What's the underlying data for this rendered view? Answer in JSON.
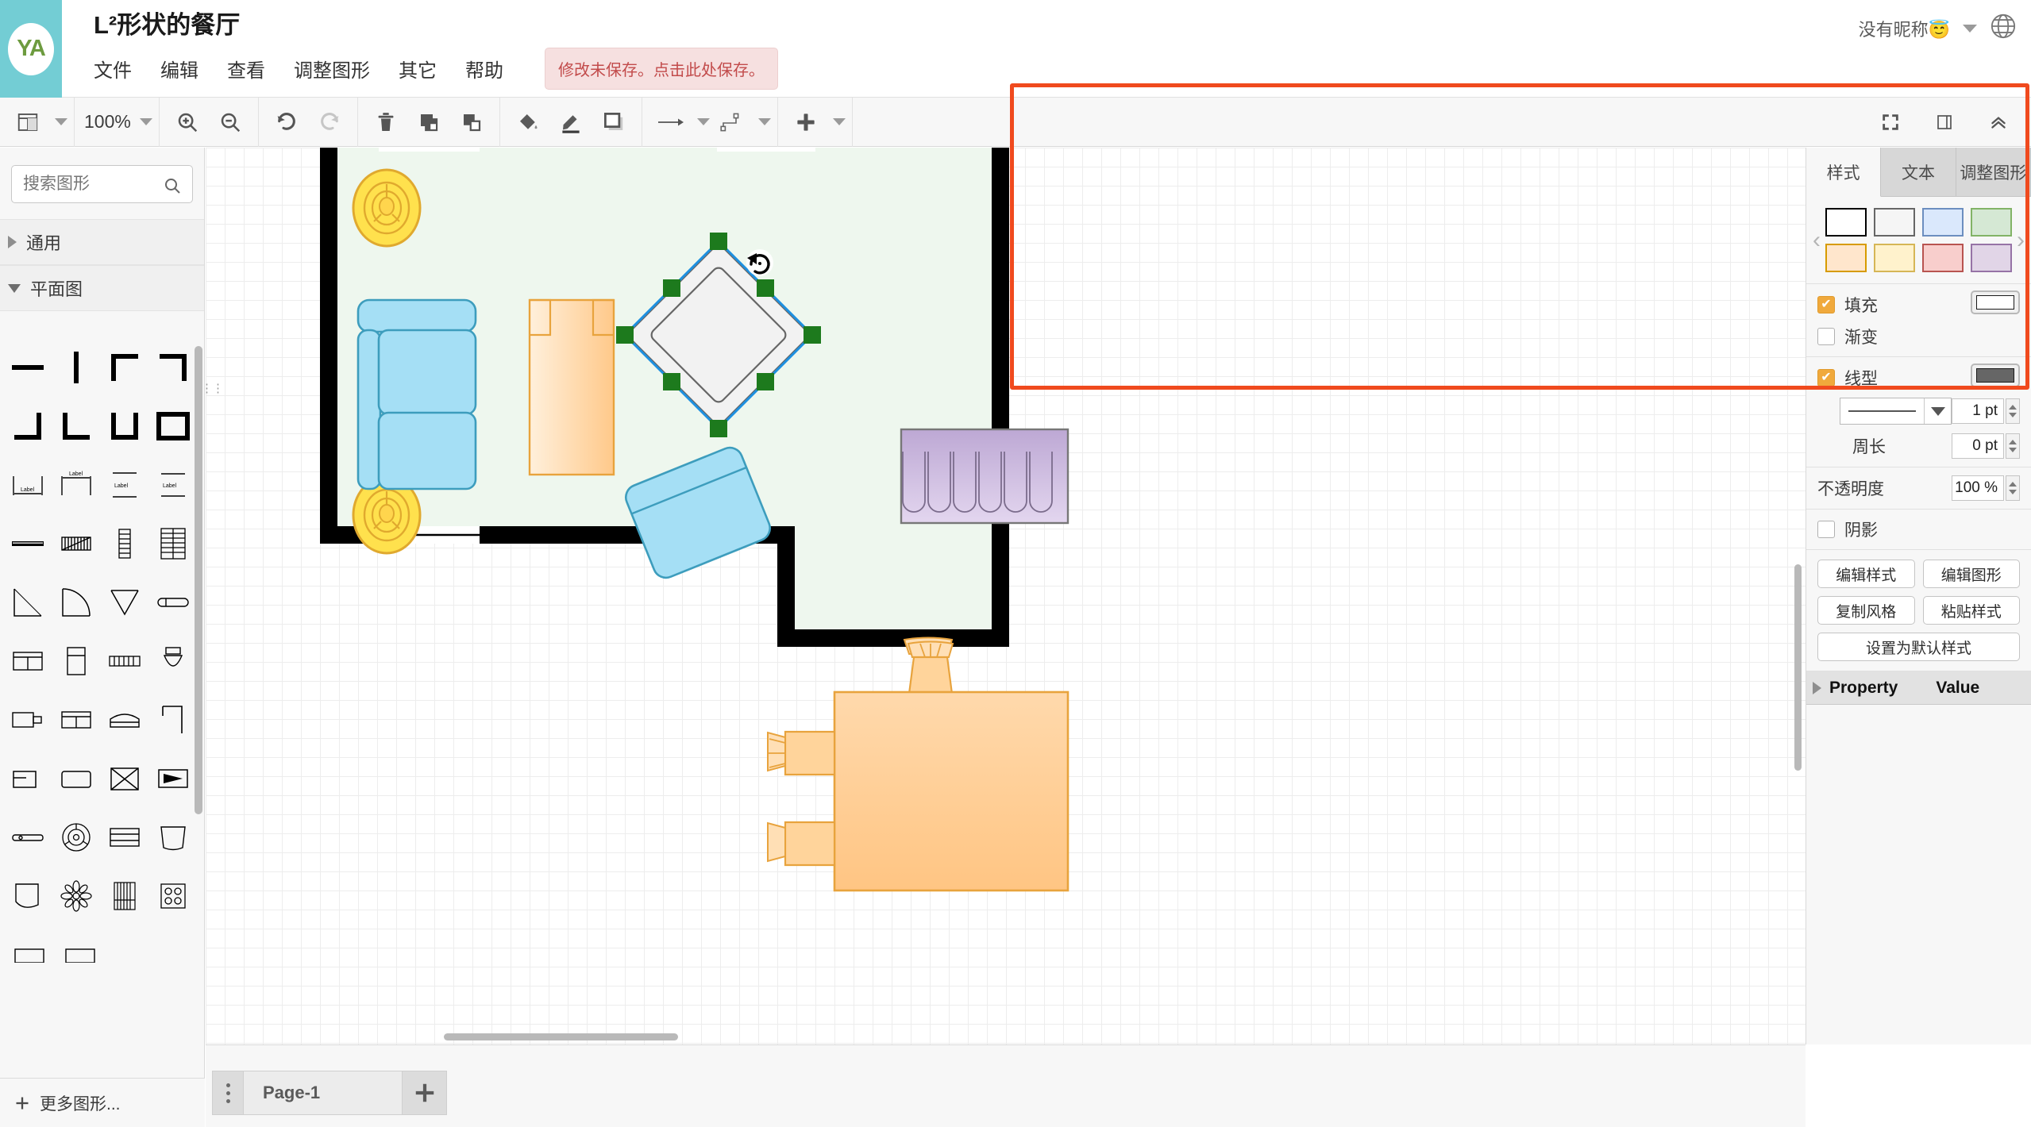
{
  "header": {
    "logo_initials": "YA",
    "doc_title": "L²形状的餐厅",
    "menu": [
      "文件",
      "编辑",
      "查看",
      "调整图形",
      "其它",
      "帮助"
    ],
    "save_banner": "修改未保存。点击此处保存。",
    "user_name": "没有昵称😇"
  },
  "toolbar": {
    "view_icon": "layout-icon",
    "zoom_level": "100%",
    "zoom_in_icon": "zoom-in-icon",
    "zoom_out_icon": "zoom-out-icon",
    "undo_icon": "undo-icon",
    "redo_icon": "redo-icon",
    "delete_icon": "trash-icon",
    "to_front_icon": "bring-to-front-icon",
    "to_back_icon": "send-to-back-icon",
    "fill_icon": "fill-color-icon",
    "line_icon": "line-color-icon",
    "shadow_icon": "shadow-icon",
    "connection_icon": "arrow-connector-icon",
    "waypoint_icon": "waypoint-icon",
    "insert_icon": "plus-icon",
    "fullscreen_icon": "fullscreen-icon",
    "panel_icon": "toggle-panel-icon",
    "collapse_icon": "collapse-toolbar-icon"
  },
  "sidebar": {
    "search_placeholder": "搜索图形",
    "search_value": "",
    "sections": [
      {
        "label": "通用",
        "expanded": false
      },
      {
        "label": "平面图",
        "expanded": true
      }
    ],
    "more_shapes": "更多图形..."
  },
  "format_panel": {
    "tabs": [
      {
        "label": "样式",
        "active": true
      },
      {
        "label": "文本",
        "active": false
      },
      {
        "label": "调整图形",
        "active": false
      }
    ],
    "swatches": [
      {
        "fill": "#ffffff",
        "stroke": "#000000"
      },
      {
        "fill": "#f5f5f5",
        "stroke": "#666666"
      },
      {
        "fill": "#dae8fc",
        "stroke": "#6c8ebf"
      },
      {
        "fill": "#d5e8d4",
        "stroke": "#82b366"
      },
      {
        "fill": "#ffe6cc",
        "stroke": "#d79b00"
      },
      {
        "fill": "#fff2cc",
        "stroke": "#d6b656"
      },
      {
        "fill": "#f8cecc",
        "stroke": "#b85450"
      },
      {
        "fill": "#e1d5e7",
        "stroke": "#9673a6"
      }
    ],
    "prev_arrow": "‹",
    "next_arrow": "›",
    "fill": {
      "label": "填充",
      "checked": true,
      "color": "#ffffff"
    },
    "gradient": {
      "label": "渐变",
      "checked": false
    },
    "line": {
      "label": "线型",
      "checked": true,
      "color": "#666666"
    },
    "line_width": "1 pt",
    "perimeter": {
      "label": "周长",
      "value": "0 pt"
    },
    "opacity": {
      "label": "不透明度",
      "value": "100 %"
    },
    "shadow": {
      "label": "阴影",
      "checked": false
    },
    "buttons": {
      "edit_style": "编辑样式",
      "edit_shape": "编辑图形",
      "copy_style": "复制风格",
      "paste_style": "粘贴样式",
      "set_default": "设置为默认样式"
    },
    "property_table": {
      "property_header": "Property",
      "value_header": "Value"
    }
  },
  "footer": {
    "page_name": "Page-1",
    "add_page_icon": "plus-icon",
    "page_menu_icon": "kebab-menu-icon"
  },
  "canvas": {
    "floor_fill": "#eef7ee",
    "wall_color": "#000000",
    "selection_handle_color": "#1d7a1d",
    "selection_outline_color": "#1e90e0",
    "rotate_icon": "rotate-handle-icon",
    "objects": [
      {
        "name": "sofa-left",
        "type": "sofa",
        "fill": "#a5dff5",
        "stroke": "#3d9dbd"
      },
      {
        "name": "rug-center",
        "type": "rug",
        "fill": "#ffd9ac",
        "stroke": "#e8a33d"
      },
      {
        "name": "armchair-lower",
        "type": "armchair",
        "fill": "#a5dff5",
        "stroke": "#3d9dbd"
      },
      {
        "name": "round-table-selected",
        "type": "table",
        "fill": "#f2f2f2",
        "stroke": "#666666",
        "selected": true
      },
      {
        "name": "ceiling-lamp-top",
        "type": "lamp",
        "fill": "#ffe14d",
        "stroke": "#e0a92e"
      },
      {
        "name": "ceiling-lamp-bottom",
        "type": "lamp",
        "fill": "#ffe14d",
        "stroke": "#e0a92e"
      },
      {
        "name": "curtain-right",
        "type": "curtain",
        "fill": "#ccbbdd",
        "stroke": "#777777"
      },
      {
        "name": "dining-table-right",
        "type": "dining-table",
        "fill": "#ffd9ac",
        "stroke": "#e8a33d"
      },
      {
        "name": "window-top-left",
        "type": "window"
      },
      {
        "name": "window-top-right",
        "type": "window"
      },
      {
        "name": "window-bottom",
        "type": "window"
      }
    ]
  }
}
